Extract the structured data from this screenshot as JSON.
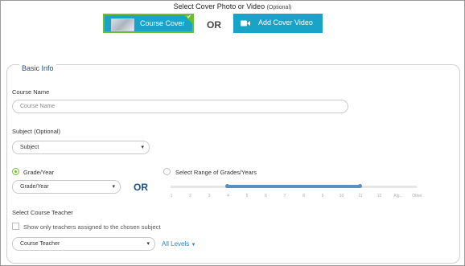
{
  "cover": {
    "title": "Select Cover Photo or Video",
    "title_optional": "(Optional)",
    "cover_button": "Course Cover",
    "or": "OR",
    "video_button": "Add Cover Video"
  },
  "basic_info": {
    "legend": "Basic Info",
    "course_name_label": "Course Name",
    "course_name_placeholder": "Course Name",
    "subject_label": "Subject (Optional)",
    "subject_value": "Subject",
    "grade_radio_label": "Grade/Year",
    "grade_value": "Grade/Year",
    "or": "OR",
    "range_radio_label": "Select Range of Grades/Years",
    "range_ticks": [
      "1",
      "2",
      "3",
      "4",
      "5",
      "6",
      "7",
      "8",
      "9",
      "10",
      "11",
      "12",
      "Alg...",
      "Other"
    ],
    "range_selected": {
      "from": "4",
      "to": "11"
    },
    "teacher_label": "Select Course Teacher",
    "teacher_checkbox_label": "Show only teachers assigned to the chosen subject",
    "teacher_value": "Course Teacher",
    "levels_link": "All Levels"
  },
  "colors": {
    "accent_teal": "#19a3c7",
    "selected_green": "#6bbf2f",
    "legend_blue": "#1e4f87",
    "slider_blue": "#5b8fbf",
    "link_blue": "#2a86c8"
  }
}
